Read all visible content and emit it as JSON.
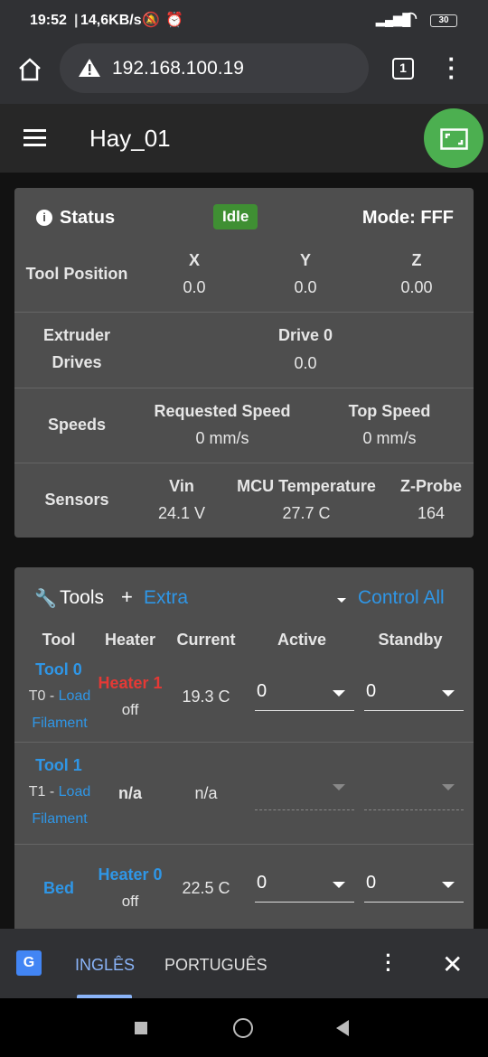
{
  "statusbar": {
    "time": "19:52",
    "speed": "14,6KB/s",
    "battery": "30"
  },
  "browser": {
    "url": "192.168.100.19",
    "tabs_count": "1"
  },
  "app": {
    "title": "Hay_01",
    "accent": "#4caf50"
  },
  "status": {
    "title": "Status",
    "state": "Idle",
    "mode": "Mode: FFF",
    "tool_position": {
      "label": "Tool Position",
      "axes": [
        {
          "name": "X",
          "value": "0.0"
        },
        {
          "name": "Y",
          "value": "0.0"
        },
        {
          "name": "Z",
          "value": "0.00"
        }
      ]
    },
    "extruder": {
      "label_line1": "Extruder",
      "label_line2": "Drives",
      "drive_name": "Drive 0",
      "drive_value": "0.0"
    },
    "speeds": {
      "label": "Speeds",
      "requested_label": "Requested Speed",
      "requested_value": "0 mm/s",
      "top_label": "Top Speed",
      "top_value": "0 mm/s"
    },
    "sensors": {
      "label": "Sensors",
      "items": [
        {
          "name": "Vin",
          "value": "24.1 V"
        },
        {
          "name": "MCU Temperature",
          "value": "27.7 C"
        },
        {
          "name": "Z-Probe",
          "value": "164"
        }
      ]
    }
  },
  "tools": {
    "title": "Tools",
    "extra": "Extra",
    "control_all": "Control All",
    "headers": [
      "Tool",
      "Heater",
      "Current",
      "Active",
      "Standby"
    ],
    "rows": [
      {
        "tool": "Tool 0",
        "prefix": "T0 - ",
        "load": "Load",
        "filament": "Filament",
        "heater": "Heater 1",
        "heater_state": "off",
        "current": "19.3 C",
        "active": "0",
        "standby": "0"
      },
      {
        "tool": "Tool 1",
        "prefix": "T1 - ",
        "load": "Load",
        "filament": "Filament",
        "heater": "n/a",
        "current": "n/a"
      },
      {
        "tool": "Bed",
        "heater": "Heater 0",
        "heater_state": "off",
        "current": "22.5 C",
        "active": "0",
        "standby": "0"
      }
    ]
  },
  "translate": {
    "lang1": "INGLÊS",
    "lang2": "PORTUGUÊS"
  }
}
